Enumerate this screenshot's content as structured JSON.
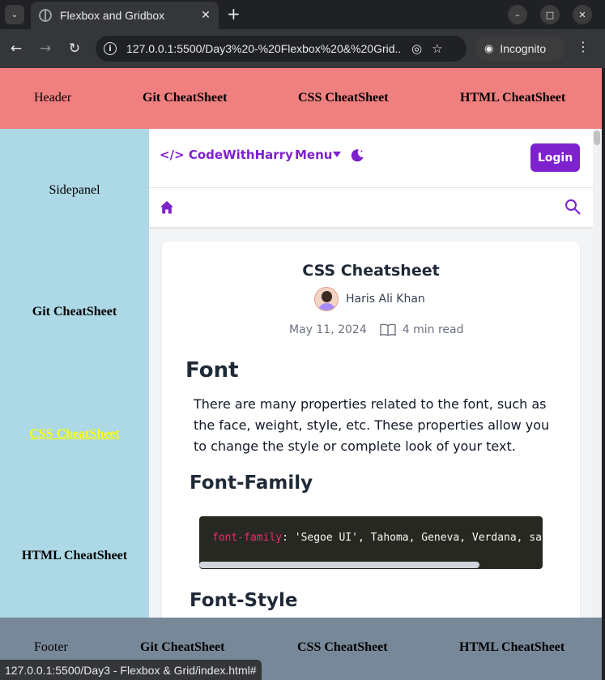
{
  "browser": {
    "tab_title": "Flexbox and Gridbox",
    "url": "127.0.0.1:5500/Day3%20-%20Flexbox%20&%20Grid...",
    "incognito_label": "Incognito",
    "status_url": "127.0.0.1:5500/Day3 - Flexbox & Grid/index.html#"
  },
  "site": {
    "header": {
      "label": "Header",
      "links": [
        "Git CheatSheet",
        "CSS CheatSheet",
        "HTML CheatSheet"
      ]
    },
    "sidepanel": {
      "label": "Sidepanel",
      "links": [
        "Git CheatSheet",
        "CSS CheatSheet",
        "HTML CheatSheet"
      ],
      "active_link": "CSS CheatSheet"
    },
    "footer": {
      "label": "Footer",
      "links": [
        "Git CheatSheet",
        "CSS CheatSheet",
        "HTML CheatSheet"
      ]
    }
  },
  "cwh": {
    "logo_text": "</> CodeWithHarry",
    "menu_label": "Menu",
    "login_label": "Login",
    "article": {
      "title": "CSS Cheatsheet",
      "author": "Haris Ali Khan",
      "date": "May 11, 2024",
      "read_time": "4 min read",
      "h_font": "Font",
      "paragraph": "There are many properties related to the font, such as the face, weight, style, etc. These properties allow you to change the style or complete look of your text.",
      "h_family": "Font-Family",
      "code_property": "font-family",
      "code_rest": ": 'Segoe UI', Tahoma, Geneva, Verdana, sans-serif;",
      "h_style": "Font-Style"
    }
  },
  "colors": {
    "header_bg": "#f08080",
    "sidepanel_bg": "#add8e6",
    "footer_bg": "#778899",
    "cwh_purple": "#7e22ce",
    "active_link": "#ffff00"
  }
}
